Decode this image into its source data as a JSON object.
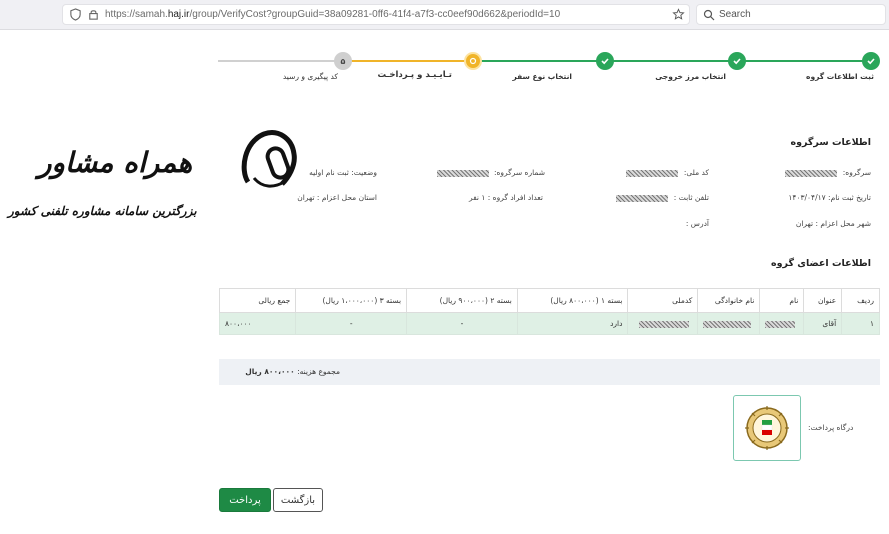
{
  "browser": {
    "url_prefix": "https://samah.",
    "url_domain": "haj.ir",
    "url_suffix": "/group/VerifyCost?groupGuid=38a09281-0ff6-41f4-a7f3-cc0eef90d662&periodId=10",
    "search_placeholder": "Search"
  },
  "stepper": {
    "steps": [
      {
        "label": "ثبت اطلاعات گروه",
        "state": "done"
      },
      {
        "label": "انتخاب مرز خروجی",
        "state": "done"
      },
      {
        "label": "انتخاب نوع سفر",
        "state": "done"
      },
      {
        "label": "تـایـیـد و پـرداخـت",
        "state": "active"
      },
      {
        "label": "کد پیگیری و رسید",
        "state": "pending",
        "number": "۵"
      }
    ]
  },
  "leader": {
    "title": "اطلاعات سرگروه",
    "leader_label": "سرگروه:",
    "national_code_label": "کد ملی:",
    "leader_number_label": "شماره سرگروه:",
    "status": "وضعیت: ثبت نام اولیه",
    "reg_date": "تاریخ ثبت نام: ۱۴۰۳/۰۴/۱۷",
    "phone_label": "تلفن ثابت :",
    "group_count": "تعداد افراد گروه : ۱ نفر",
    "province": "استان محل اعزام : تهران",
    "city": "شهر محل اعزام : تهران",
    "address": "آدرس :"
  },
  "members": {
    "title": "اطلاعات اعضای گروه",
    "headers": [
      "ردیف",
      "عنوان",
      "نام",
      "نام خانوادگی",
      "کدملی",
      "بسته ۱ (۸۰۰،۰۰۰ ریال)",
      "بسته ۲ (۹۰۰،۰۰۰ ریال)",
      "بسته ۳ (۱،۰۰۰،۰۰۰ ریال)",
      "جمع ریالی"
    ],
    "rows": [
      {
        "row": "۱",
        "title": "آقای",
        "pkg1": "دارد",
        "pkg2": "-",
        "pkg3": "-",
        "sum": "۸۰۰،۰۰۰"
      }
    ]
  },
  "total": {
    "label": "مجموع هزینه:",
    "value": "۸۰۰،۰۰۰ ریال"
  },
  "gateway": {
    "label": "درگاه پرداخت:"
  },
  "buttons": {
    "pay": "پرداخت",
    "back": "بازگشت"
  },
  "watermark": {
    "brand": "همراه مشاور",
    "tagline": "بزرگترین سامانه مشاوره تلفنی کشور"
  },
  "colors": {
    "success": "#2aa65a",
    "active": "#f0b429",
    "pay_button": "#1e8a45",
    "row_bg": "#dff0e5"
  }
}
